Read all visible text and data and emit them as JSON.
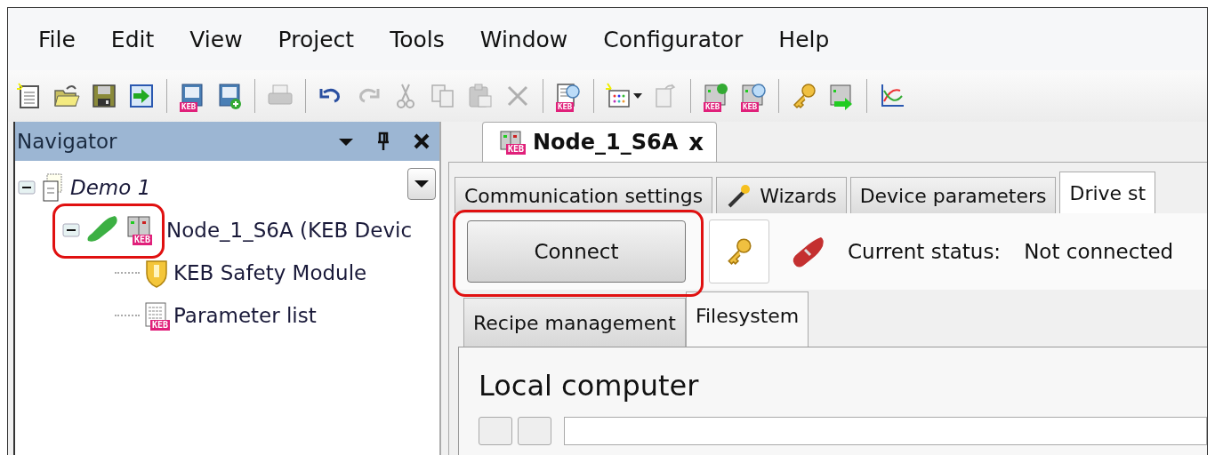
{
  "menu": [
    {
      "label": "File"
    },
    {
      "label": "Edit"
    },
    {
      "label": "View"
    },
    {
      "label": "Project"
    },
    {
      "label": "Tools"
    },
    {
      "label": "Window"
    },
    {
      "label": "Configurator"
    },
    {
      "label": "Help"
    }
  ],
  "toolbar": [
    {
      "kind": "new",
      "disabled": false
    },
    {
      "kind": "open",
      "disabled": false
    },
    {
      "kind": "save",
      "disabled": false
    },
    {
      "kind": "import",
      "disabled": false
    },
    {
      "kind": "separator"
    },
    {
      "kind": "book",
      "disabled": false,
      "badge": "KEB"
    },
    {
      "kind": "book-add",
      "disabled": false
    },
    {
      "kind": "separator"
    },
    {
      "kind": "print",
      "disabled": true
    },
    {
      "kind": "separator"
    },
    {
      "kind": "undo",
      "disabled": false
    },
    {
      "kind": "redo",
      "disabled": true
    },
    {
      "kind": "cut",
      "disabled": true
    },
    {
      "kind": "copy",
      "disabled": true
    },
    {
      "kind": "paste",
      "disabled": true
    },
    {
      "kind": "delete",
      "disabled": true
    },
    {
      "kind": "separator"
    },
    {
      "kind": "doc-search",
      "disabled": false,
      "badge": "KEB"
    },
    {
      "kind": "separator"
    },
    {
      "kind": "grid-new",
      "disabled": false,
      "dropdown": true
    },
    {
      "kind": "doc-export",
      "disabled": true
    },
    {
      "kind": "separator"
    },
    {
      "kind": "device-add",
      "disabled": false,
      "badge": "KEB"
    },
    {
      "kind": "device-search",
      "disabled": false,
      "badge": "KEB"
    },
    {
      "kind": "separator"
    },
    {
      "kind": "key",
      "disabled": false
    },
    {
      "kind": "device-send",
      "disabled": false
    },
    {
      "kind": "separator"
    },
    {
      "kind": "chart",
      "disabled": false
    }
  ],
  "navigator": {
    "title": "Navigator",
    "tree": [
      {
        "label": "Demo 1",
        "expanded": true,
        "children": [
          {
            "label": "Node_1_S6A (KEB Devic",
            "badge": "KEB",
            "expanded": true,
            "highlighted": true,
            "children": [
              {
                "label": "KEB Safety Module",
                "kind": "safety"
              },
              {
                "label": "Parameter list",
                "kind": "params",
                "badge": "KEB"
              }
            ]
          }
        ]
      }
    ]
  },
  "document_tab": {
    "label": "Node_1_S6A",
    "badge": "KEB",
    "close": "x"
  },
  "tabs": [
    {
      "label": "Communication settings",
      "selected": false,
      "kind": "plain"
    },
    {
      "label": "Wizards",
      "selected": false,
      "kind": "wand"
    },
    {
      "label": "Device parameters",
      "selected": false,
      "kind": "plain"
    },
    {
      "label": "Drive st",
      "selected": true,
      "kind": "plain"
    }
  ],
  "connection": {
    "button": "Connect",
    "highlighted": true,
    "status_label": "Current status:",
    "status": "Not connected",
    "connected": false
  },
  "inner_tabs": [
    {
      "label": "Recipe management",
      "selected": false
    },
    {
      "label": "Filesystem",
      "selected": true
    }
  ],
  "filesystem": {
    "heading": "Local computer"
  }
}
